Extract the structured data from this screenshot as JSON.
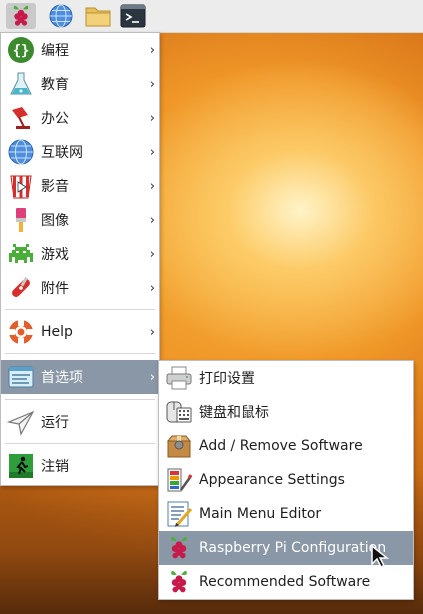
{
  "taskbar": {
    "buttons": [
      {
        "icon": "raspberry-pi-icon"
      },
      {
        "icon": "web-browser-icon"
      },
      {
        "icon": "file-manager-icon"
      },
      {
        "icon": "terminal-icon"
      }
    ]
  },
  "main_menu": {
    "items": [
      {
        "label": "编程",
        "icon": "programming-icon"
      },
      {
        "label": "教育",
        "icon": "education-icon"
      },
      {
        "label": "办公",
        "icon": "office-icon"
      },
      {
        "label": "互联网",
        "icon": "internet-icon"
      },
      {
        "label": "影音",
        "icon": "sound-video-icon"
      },
      {
        "label": "图像",
        "icon": "graphics-icon"
      },
      {
        "label": "游戏",
        "icon": "games-icon"
      },
      {
        "label": "附件",
        "icon": "accessories-icon"
      },
      {
        "label": "Help",
        "icon": "help-icon"
      },
      {
        "label": "首选项",
        "icon": "preferences-icon"
      },
      {
        "label": "运行",
        "icon": "run-icon"
      },
      {
        "label": "注销",
        "icon": "logout-icon"
      }
    ],
    "arrow": "›",
    "active_item": "首选项"
  },
  "preferences_submenu": {
    "items": [
      {
        "label": "打印设置",
        "icon": "printer-icon"
      },
      {
        "label": "键盘和鼠标",
        "icon": "keyboard-mouse-icon"
      },
      {
        "label": "Add / Remove Software",
        "icon": "package-icon"
      },
      {
        "label": "Appearance Settings",
        "icon": "appearance-icon"
      },
      {
        "label": "Main Menu Editor",
        "icon": "menu-editor-icon"
      },
      {
        "label": "Raspberry Pi Configuration",
        "icon": "raspberry-pi-icon"
      },
      {
        "label": "Recommended Software",
        "icon": "raspberry-pi-icon"
      }
    ],
    "active_item": "Raspberry Pi Configuration"
  },
  "colors": {
    "highlight": "#8a97a6",
    "menu_bg": "#ffffff",
    "taskbar_bg": "#ececec"
  }
}
